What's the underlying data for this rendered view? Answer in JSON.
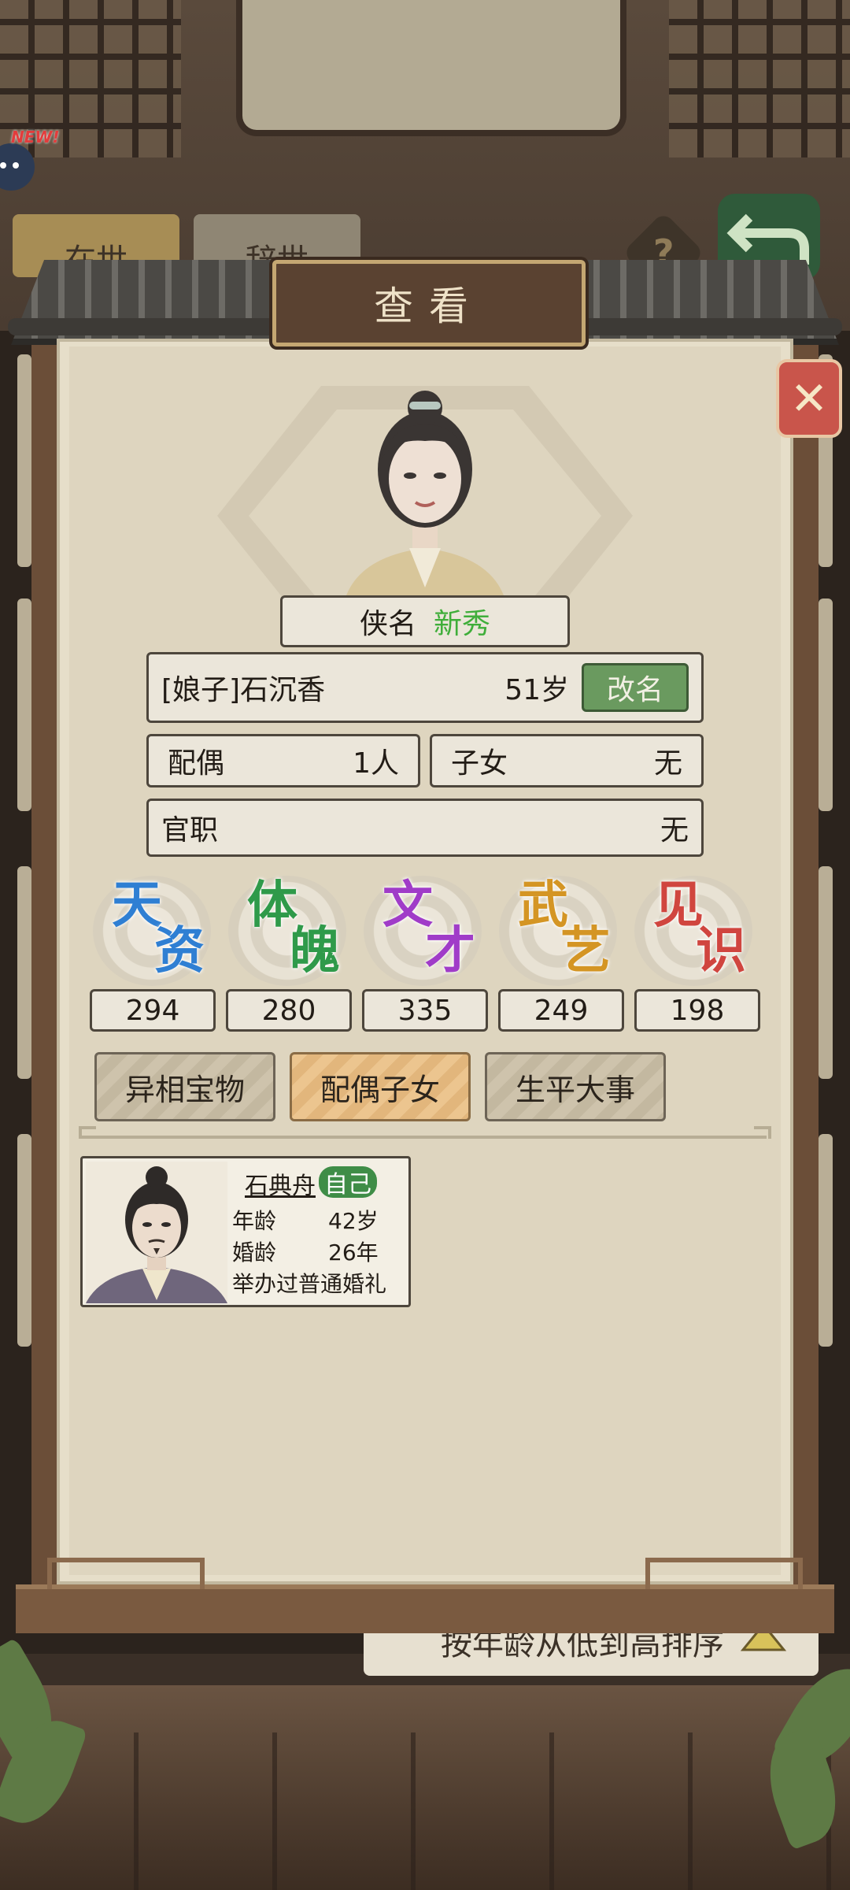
{
  "background": {
    "tabs": [
      "在世",
      "辞世"
    ],
    "new_badge": "NEW!",
    "help_icon": "?",
    "sort_label": "按年龄从低到高排序"
  },
  "dialog": {
    "title": "查看",
    "close_icon": "close-icon",
    "title_label": "侠名",
    "title_value": "新秀",
    "name": "[娘子]石沉香",
    "age": "51岁",
    "rename_label": "改名",
    "spouse_label": "配偶",
    "spouse_value": "1人",
    "children_label": "子女",
    "children_value": "无",
    "office_label": "官职",
    "office_value": "无",
    "stats": [
      {
        "label": "天资",
        "c1": "天",
        "c2": "资",
        "value": "294",
        "color": "#2f7fd3"
      },
      {
        "label": "体魄",
        "c1": "体",
        "c2": "魄",
        "value": "280",
        "color": "#2f9a4a"
      },
      {
        "label": "文才",
        "c1": "文",
        "c2": "才",
        "value": "335",
        "color": "#a03cc8"
      },
      {
        "label": "武艺",
        "c1": "武",
        "c2": "艺",
        "value": "249",
        "color": "#d49524"
      },
      {
        "label": "见识",
        "c1": "见",
        "c2": "识",
        "value": "198",
        "color": "#d0453f"
      }
    ],
    "tabs": [
      {
        "label": "异相宝物",
        "active": false
      },
      {
        "label": "配偶子女",
        "active": true
      },
      {
        "label": "生平大事",
        "active": false
      }
    ],
    "spouse_card": {
      "name": "石典舟",
      "badge": "自己",
      "age_label": "年龄",
      "age_value": "42岁",
      "marriage_label": "婚龄",
      "marriage_value": "26年",
      "ceremony": "举办过普通婚礼"
    }
  }
}
